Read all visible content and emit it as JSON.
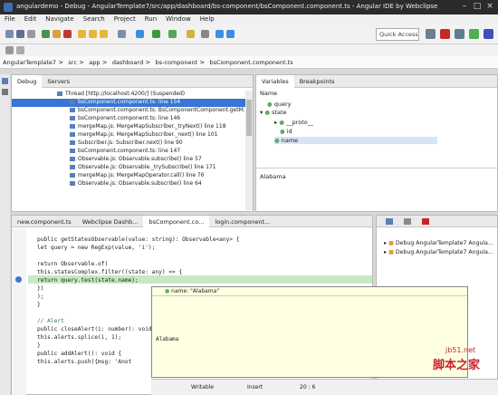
{
  "window": {
    "title": "angulardemo - Debug - AngularTemplate7/src/app/dashboard/bs-component/bsComponent.component.ts - Angular IDE by Webclipse"
  },
  "menu": [
    "File",
    "Edit",
    "Navigate",
    "Search",
    "Project",
    "Run",
    "Window",
    "Help"
  ],
  "toolbar": {
    "quick_access": "Quick Access"
  },
  "breadcrumb": [
    "AngularTemplate7",
    "src",
    "app",
    "dashboard",
    "bs-component",
    "bsComponent.component.ts"
  ],
  "debug_panel": {
    "tabs": [
      "Debug",
      "Servers"
    ],
    "frames": [
      "Thread [http://localhost:4200/] (Suspended)",
      "bsComponent.component.ts: line 154",
      "bsComponent.component.ts: BsComponentComponent.getM...",
      "bsComponent.component.ts: line 146",
      "mergeMap.js: MergeMapSubscriber._tryNext() line 118",
      "mergeMap.js: MergeMapSubscriber._next() line 101",
      "Subscriber.js: Subscriber.next() line 90",
      "bsComponent.component.ts: line 147",
      "Observable.js: Observable.subscribe() line 57",
      "Observable.js: Observable._trySubscribe() line 171",
      "mergeMap.js: MergeMapOperator.call() line 76",
      "Observable.js: Observable.subscribe() line 64"
    ]
  },
  "vars_panel": {
    "tabs": [
      "Variables",
      "Breakpoints"
    ],
    "header": "Name",
    "rows": [
      "query",
      "state",
      "__proto__",
      "id",
      "name"
    ],
    "detail_label": "Alabama"
  },
  "editor": {
    "tabs": [
      "new.component.ts",
      "Webclipse Dashb...",
      "bsComponent.co...",
      "login.component..."
    ],
    "lines": [
      "public getStatesObservable(value: string): Observable<any> {",
      "  let query = new RegExp(value, 'i');",
      "",
      "  return Observable.of(",
      "    this.statesComplex.filter((state: any) => {",
      "      return query.test(state.name);",
      "    })",
      "  );",
      "}",
      "",
      "// Alert",
      "public closeAlert(i: number): void {",
      "  this.alerts.splice(i, 1);",
      "}",
      "public addAlert(): void {",
      "  this.alerts.push({msg: 'Anot"
    ]
  },
  "hover": {
    "header": "name: \"Alabama\"",
    "value": "Alabama"
  },
  "outline": {
    "items": [
      "Debug AngularTemplate7 Angula...",
      "Debug AngularTemplate7 Angula..."
    ]
  },
  "statusbar": {
    "mode": "Writable",
    "insert": "Insert",
    "position": "20 : 6"
  },
  "watermark": {
    "url": "jb51.net",
    "text": "脚本之家"
  }
}
